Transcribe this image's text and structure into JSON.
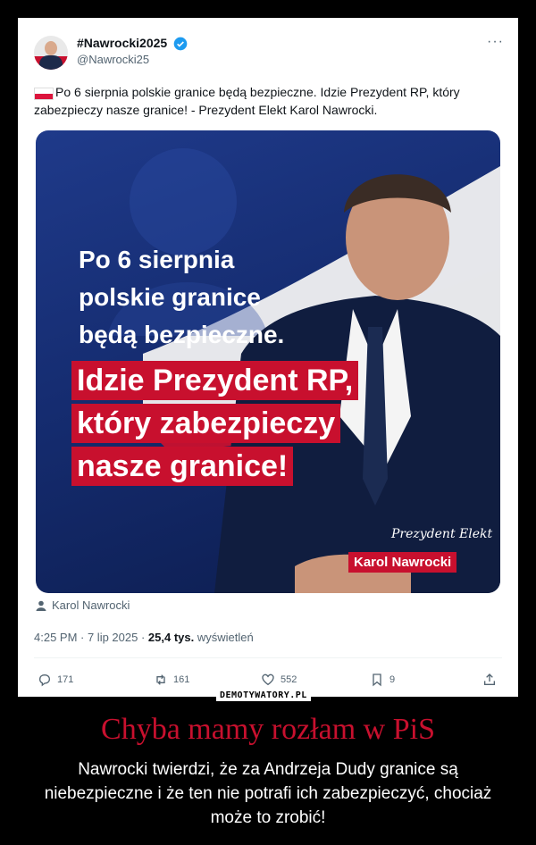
{
  "tweet": {
    "display_name": "#Nawrocki2025",
    "handle": "@Nawrocki25",
    "more_label": "···",
    "text": "Po 6 sierpnia polskie granice będą bezpieczne. Idzie Prezydent RP, który zabezpieczy nasze granice! - Prezydent Elekt Karol Nawrocki.",
    "image": {
      "line1": "Po 6 sierpnia",
      "line2": "polskie granice",
      "line3": "będą bezpieczne.",
      "red1": "Idzie Prezydent RP,",
      "red2": "który zabezpieczy",
      "red3": "nasze granice!",
      "signature": "Prezydent Elekt",
      "signature_name": "Karol Nawrocki"
    },
    "tagged_user": "Karol Nawrocki",
    "time": "4:25 PM · 7 lip 2025 · ",
    "views": "25,4 tys.",
    "views_label": " wyświetleń",
    "actions": {
      "replies": "171",
      "reposts": "161",
      "likes": "552",
      "bookmarks": "9"
    }
  },
  "watermark": "DEMOTYWATORY.PL",
  "caption": {
    "title": "Chyba mamy rozłam w PiS",
    "subtitle": "Nawrocki twierdzi, że za Andrzeja Dudy granice są niebezpieczne i że ten nie potrafi ich zabezpieczyć, chociaż może to zrobić!"
  },
  "colors": {
    "accent_red": "#c8102e",
    "verified_blue": "#1d9bf0",
    "navy": "#152c70"
  }
}
